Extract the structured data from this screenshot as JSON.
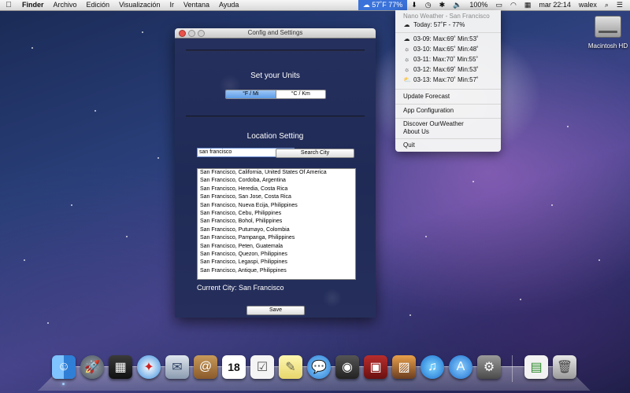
{
  "menubar": {
    "apple": "",
    "app": "Finder",
    "menus": [
      "Archivo",
      "Edición",
      "Visualización",
      "Ir",
      "Ventana",
      "Ayuda"
    ],
    "weather_status": "57˚F 77%",
    "battery": "100%",
    "clock": "mar 22:14",
    "user": "walex"
  },
  "desktop": {
    "hd_label": "Macintosh HD"
  },
  "window": {
    "title": "Config and Settings",
    "units_title": "Set your Units",
    "unit_options": [
      "°F / Mi",
      "°C / Km"
    ],
    "selected_unit": "°F / Mi",
    "location_title": "Location Setting",
    "city_input": "san francisco",
    "search_button": "Search City",
    "results": [
      "San Francisco, California, United States Of America",
      "San Francisco, Cordoba, Argentina",
      "San Francisco, Heredia, Costa Rica",
      "San Francisco, San Jose, Costa Rica",
      "San Francisco, Nueva Ecija, Philippines",
      "San Francisco, Cebu, Philippines",
      "San Francisco, Bohol, Philippines",
      "San Francisco, Putumayo, Colombia",
      "San Francisco, Pampanga, Philippines",
      "San Francisco, Peten, Guatemala",
      "San Francisco, Quezon, Philippines",
      "San Francisco, Legaspi, Philippines",
      "San Francisco, Antique, Philippines"
    ],
    "current_city": "Current City: San Francisco",
    "save_button": "Save"
  },
  "weather_menu": {
    "header": "Nano Weather - San Francisco",
    "today": "Today: 57˚F - 77%",
    "forecast": [
      {
        "icon": "cloud-icon",
        "text": "03-09: Max:69˚ Min:53˚"
      },
      {
        "icon": "sun-icon",
        "text": "03-10: Max:65˚ Min:48˚"
      },
      {
        "icon": "sun-icon",
        "text": "03-11: Max:70˚ Min:55˚"
      },
      {
        "icon": "sun-icon",
        "text": "03-12: Max:69˚ Min:53˚"
      },
      {
        "icon": "partly-cloudy-icon",
        "text": "03-13: Max:70˚ Min:57˚"
      }
    ],
    "update": "Update Forecast",
    "config": "App Configuration",
    "discover": "Discover OurWeather",
    "about": "About Us",
    "quit": "Quit"
  },
  "dock": {
    "apps": [
      "finder-icon",
      "launchpad-icon",
      "mission-control-icon",
      "safari-icon",
      "mail-icon",
      "contacts-icon",
      "calendar-icon",
      "reminders-icon",
      "notes-icon",
      "messages-icon",
      "facetime-icon",
      "photo-booth-icon",
      "iphoto-icon",
      "itunes-icon",
      "app-store-icon",
      "system-preferences-icon"
    ],
    "calendar_day": "18"
  }
}
